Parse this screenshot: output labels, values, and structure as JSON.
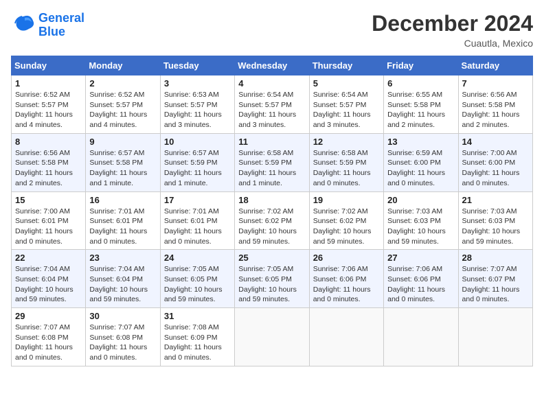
{
  "header": {
    "logo_line1": "General",
    "logo_line2": "Blue",
    "month_title": "December 2024",
    "location": "Cuautla, Mexico"
  },
  "weekdays": [
    "Sunday",
    "Monday",
    "Tuesday",
    "Wednesday",
    "Thursday",
    "Friday",
    "Saturday"
  ],
  "weeks": [
    [
      {
        "day": "1",
        "sunrise": "6:52 AM",
        "sunset": "5:57 PM",
        "daylight": "11 hours and 4 minutes."
      },
      {
        "day": "2",
        "sunrise": "6:52 AM",
        "sunset": "5:57 PM",
        "daylight": "11 hours and 4 minutes."
      },
      {
        "day": "3",
        "sunrise": "6:53 AM",
        "sunset": "5:57 PM",
        "daylight": "11 hours and 3 minutes."
      },
      {
        "day": "4",
        "sunrise": "6:54 AM",
        "sunset": "5:57 PM",
        "daylight": "11 hours and 3 minutes."
      },
      {
        "day": "5",
        "sunrise": "6:54 AM",
        "sunset": "5:57 PM",
        "daylight": "11 hours and 3 minutes."
      },
      {
        "day": "6",
        "sunrise": "6:55 AM",
        "sunset": "5:58 PM",
        "daylight": "11 hours and 2 minutes."
      },
      {
        "day": "7",
        "sunrise": "6:56 AM",
        "sunset": "5:58 PM",
        "daylight": "11 hours and 2 minutes."
      }
    ],
    [
      {
        "day": "8",
        "sunrise": "6:56 AM",
        "sunset": "5:58 PM",
        "daylight": "11 hours and 2 minutes."
      },
      {
        "day": "9",
        "sunrise": "6:57 AM",
        "sunset": "5:58 PM",
        "daylight": "11 hours and 1 minute."
      },
      {
        "day": "10",
        "sunrise": "6:57 AM",
        "sunset": "5:59 PM",
        "daylight": "11 hours and 1 minute."
      },
      {
        "day": "11",
        "sunrise": "6:58 AM",
        "sunset": "5:59 PM",
        "daylight": "11 hours and 1 minute."
      },
      {
        "day": "12",
        "sunrise": "6:58 AM",
        "sunset": "5:59 PM",
        "daylight": "11 hours and 0 minutes."
      },
      {
        "day": "13",
        "sunrise": "6:59 AM",
        "sunset": "6:00 PM",
        "daylight": "11 hours and 0 minutes."
      },
      {
        "day": "14",
        "sunrise": "7:00 AM",
        "sunset": "6:00 PM",
        "daylight": "11 hours and 0 minutes."
      }
    ],
    [
      {
        "day": "15",
        "sunrise": "7:00 AM",
        "sunset": "6:01 PM",
        "daylight": "11 hours and 0 minutes."
      },
      {
        "day": "16",
        "sunrise": "7:01 AM",
        "sunset": "6:01 PM",
        "daylight": "11 hours and 0 minutes."
      },
      {
        "day": "17",
        "sunrise": "7:01 AM",
        "sunset": "6:01 PM",
        "daylight": "11 hours and 0 minutes."
      },
      {
        "day": "18",
        "sunrise": "7:02 AM",
        "sunset": "6:02 PM",
        "daylight": "10 hours and 59 minutes."
      },
      {
        "day": "19",
        "sunrise": "7:02 AM",
        "sunset": "6:02 PM",
        "daylight": "10 hours and 59 minutes."
      },
      {
        "day": "20",
        "sunrise": "7:03 AM",
        "sunset": "6:03 PM",
        "daylight": "10 hours and 59 minutes."
      },
      {
        "day": "21",
        "sunrise": "7:03 AM",
        "sunset": "6:03 PM",
        "daylight": "10 hours and 59 minutes."
      }
    ],
    [
      {
        "day": "22",
        "sunrise": "7:04 AM",
        "sunset": "6:04 PM",
        "daylight": "10 hours and 59 minutes."
      },
      {
        "day": "23",
        "sunrise": "7:04 AM",
        "sunset": "6:04 PM",
        "daylight": "10 hours and 59 minutes."
      },
      {
        "day": "24",
        "sunrise": "7:05 AM",
        "sunset": "6:05 PM",
        "daylight": "10 hours and 59 minutes."
      },
      {
        "day": "25",
        "sunrise": "7:05 AM",
        "sunset": "6:05 PM",
        "daylight": "10 hours and 59 minutes."
      },
      {
        "day": "26",
        "sunrise": "7:06 AM",
        "sunset": "6:06 PM",
        "daylight": "11 hours and 0 minutes."
      },
      {
        "day": "27",
        "sunrise": "7:06 AM",
        "sunset": "6:06 PM",
        "daylight": "11 hours and 0 minutes."
      },
      {
        "day": "28",
        "sunrise": "7:07 AM",
        "sunset": "6:07 PM",
        "daylight": "11 hours and 0 minutes."
      }
    ],
    [
      {
        "day": "29",
        "sunrise": "7:07 AM",
        "sunset": "6:08 PM",
        "daylight": "11 hours and 0 minutes."
      },
      {
        "day": "30",
        "sunrise": "7:07 AM",
        "sunset": "6:08 PM",
        "daylight": "11 hours and 0 minutes."
      },
      {
        "day": "31",
        "sunrise": "7:08 AM",
        "sunset": "6:09 PM",
        "daylight": "11 hours and 0 minutes."
      },
      null,
      null,
      null,
      null
    ]
  ]
}
